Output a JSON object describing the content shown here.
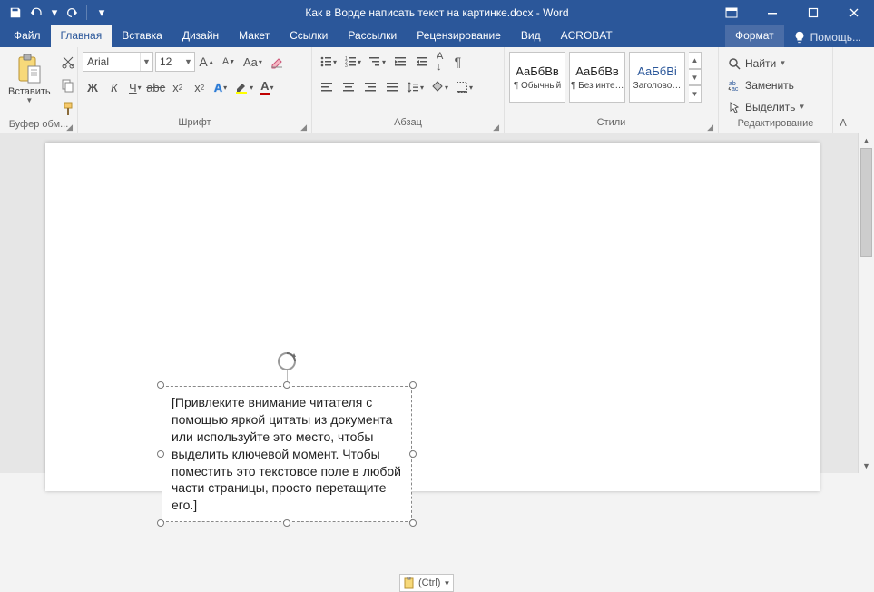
{
  "title": "Как в Ворде написать текст на картинке.docx - Word",
  "tabs": {
    "file": "Файл",
    "home": "Главная",
    "insert": "Вставка",
    "design": "Дизайн",
    "layout": "Макет",
    "references": "Ссылки",
    "mailings": "Рассылки",
    "review": "Рецензирование",
    "view": "Вид",
    "acrobat": "ACROBAT",
    "format": "Формат",
    "help_label": "Помощь..."
  },
  "groups": {
    "clipboard": {
      "label": "Буфер обм...",
      "paste": "Вставить"
    },
    "font": {
      "label": "Шрифт",
      "name": "Arial",
      "size": "12"
    },
    "paragraph": {
      "label": "Абзац"
    },
    "styles": {
      "label": "Стили",
      "s1_samp": "АаБбВв",
      "s1_name": "¶ Обычный",
      "s2_samp": "АаБбВв",
      "s2_name": "¶ Без инте…",
      "s3_samp": "АаБбВі",
      "s3_name": "Заголово…"
    },
    "editing": {
      "label": "Редактирование",
      "find": "Найти",
      "replace": "Заменить",
      "select": "Выделить"
    }
  },
  "textbox": "[Привлеките внимание читателя с помощью яркой цитаты из документа или используйте это место, чтобы выделить ключевой момент. Чтобы поместить это текстовое поле в любой части страницы, просто перетащите его.]",
  "paste_options": "(Ctrl)"
}
